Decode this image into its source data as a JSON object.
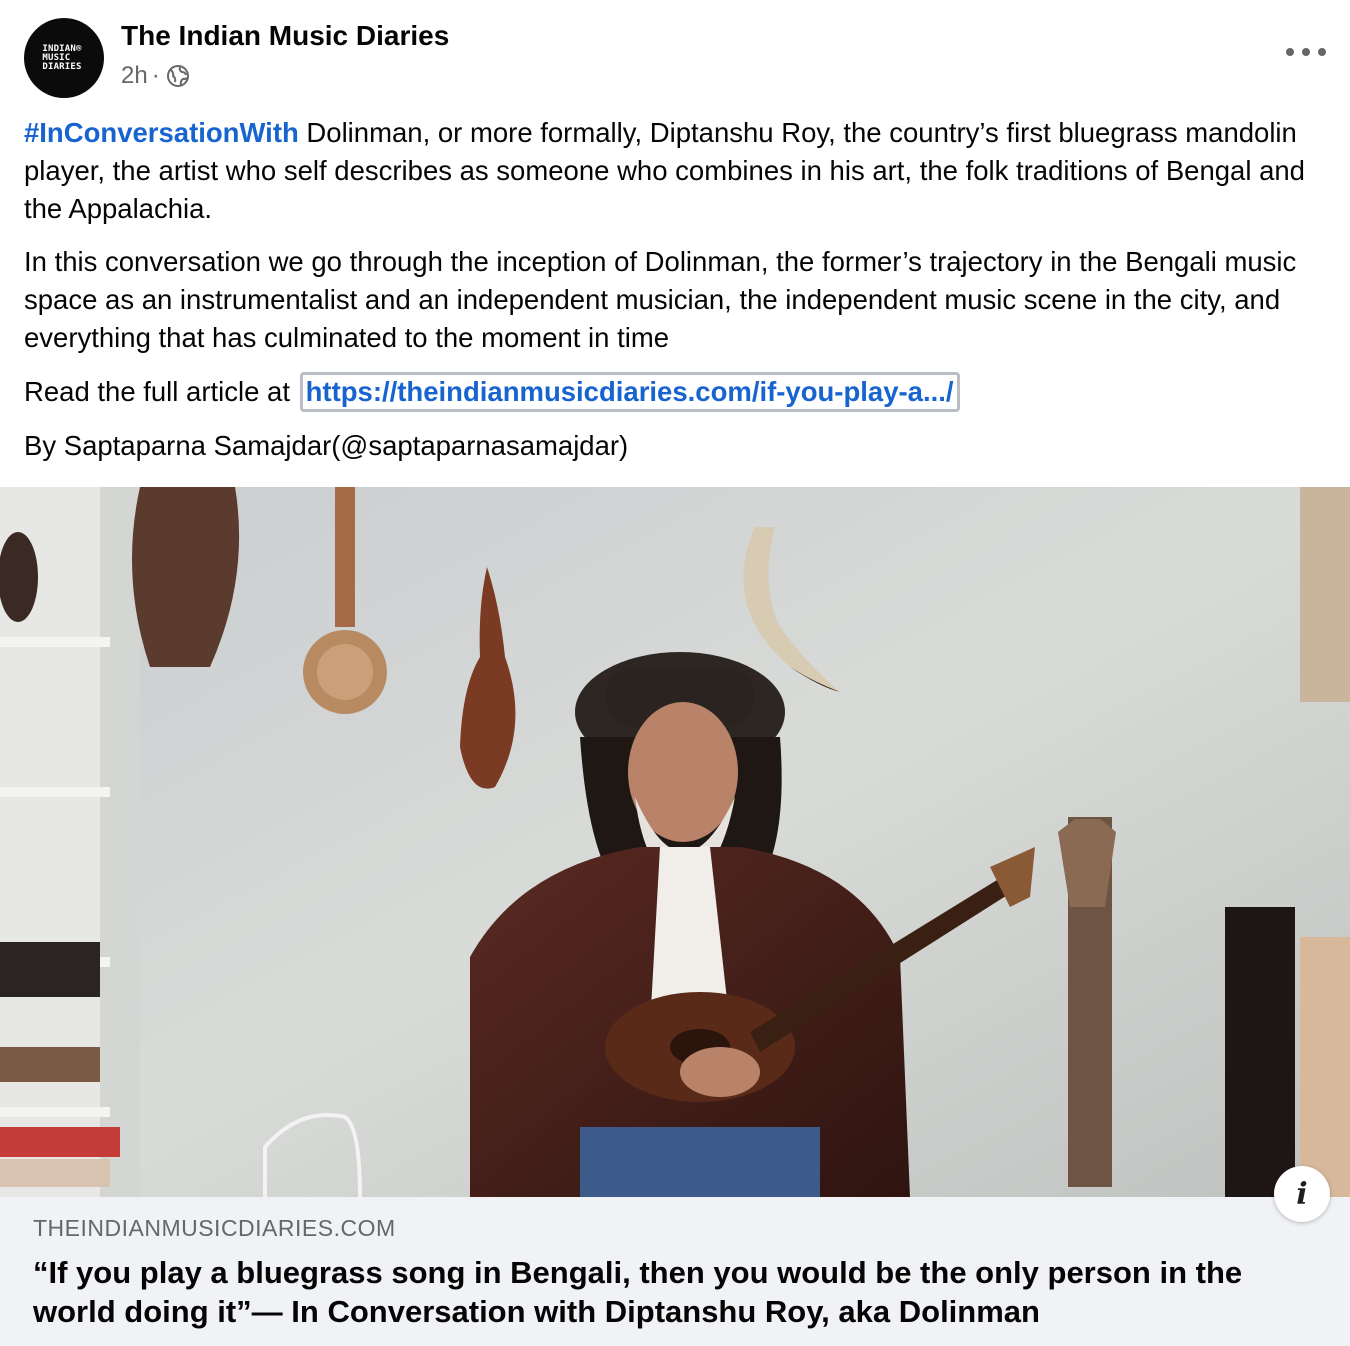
{
  "post": {
    "page_name": "The Indian Music Diaries",
    "avatar_text": "INDIAN®\nMUSIC\nDIARIES",
    "time": "2h",
    "separator": "·",
    "privacy_icon": "globe-icon",
    "more_icon": "more-options-icon"
  },
  "body": {
    "p1_hashtag": "#InConversationWith",
    "p1_text": " Dolinman, or more formally, Diptanshu Roy, the country’s first bluegrass mandolin player, the artist who self describes as someone who combines in his art, the folk traditions of Bengal and the Appalachia.",
    "p2_text": "In this conversation we go through the inception of Dolinman, the former’s trajectory in the Bengali music space as an instrumentalist and an independent musician, the independent music scene in the city, and everything that has culminated to the moment in time",
    "p3_prefix": "Read the full article at ",
    "p3_link": "https://theindianmusicdiaries.com/if-you-play-a.../",
    "p4_text": "By Saptaparna Samajdar(@saptaparnasamajdar)"
  },
  "preview": {
    "domain": "THEINDIANMUSICDIARIES.COM",
    "headline": "“If you play a bluegrass song in Bengali, then you would be the only person in the world doing it”— In Conversation with Diptanshu Roy, aka Dolinman",
    "info_icon": "info-icon",
    "info_glyph": "i"
  },
  "colors": {
    "link": "#1763cf",
    "secondary_text": "#65676b",
    "preview_bg": "#f0f2f5"
  }
}
